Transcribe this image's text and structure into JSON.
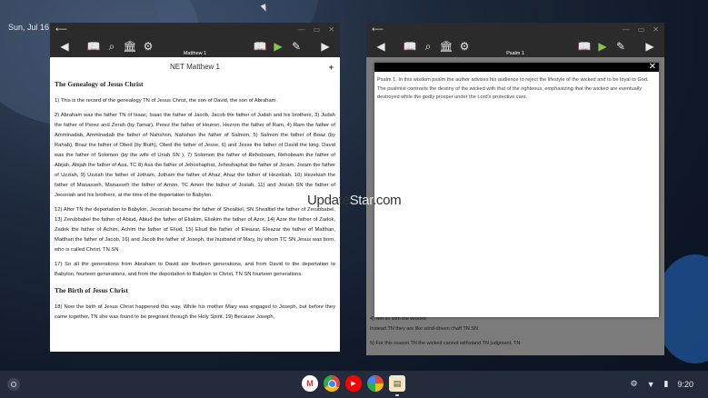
{
  "desktop": {
    "date": "Sun, Jul 16"
  },
  "left_window": {
    "subtitle": "Matthew 1",
    "page_title": "NET Matthew 1",
    "heading1": "The Genealogy of Jesus Christ",
    "heading2": "The Birth of Jesus Christ",
    "paragraphs": [
      "1)   This is the record of the genealogy  TN  of Jesus Christ, the son of David, the son of Abraham.",
      "2)   Abraham was the father  TN  of Isaac, Isaac the father of Jacob, Jacob the father of Judah and his brothers,   3)   Judah the father of Perez and Zerah (by Tamar), Perez the father of Hezron, Hezron the father of Ram,   4)   Ram the father of Amminadab, Amminadab the father of Nahshon, Nahshon the father of Salmon,   5)   Salmon the father of Boaz (by Rahab), Boaz the father of Obed (by Ruth), Obed the father of Jesse,   6)   and Jesse the father of David the king. David was the father of Solomon (by the wife of Uriah  SN ),   7)   Solomon the father of Rehoboam, Rehoboam the father of Abijah, Abijah the father of Asa,  TC   8)   Asa the father of Jehoshaphat, Jehoshaphat the father of Joram, Joram the father of Uzziah,   9)   Uzziah the father of Jotham, Jotham the father of Ahaz, Ahaz the father of Hezekiah,   10)   Hezekiah the father of Manasseh, Manasseh the father of Amon,  TC  Amon the father of Josiah,   11)   and Josiah  SN  the father of Jeconiah and his brothers, at the time of the deportation to Babylon.",
      "12)   After  TN  the deportation to Babylon, Jeconiah became the father of Shealtiel,  SN  Shealtiel the father of Zerubbabel,   13)   Zerubbabel the father of Abiud, Abiud the father of Eliakim, Eliakim the father of Azor,   14)   Azor the father of Zadok, Zadok the father of Achim, Achim the father of Eliud,   15)   Eliud the father of Eleazar, Eleazar the father of Matthan, Matthan the father of Jacob,   16)   and Jacob the father of Joseph, the husband of Mary, by whom  TC SN  Jesus was born, who is called Christ.  TN  SN",
      "17)   So all the generations from Abraham to David are fourteen generations, and from David to the deportation to Babylon, fourteen generations, and from the deportation to Babylon to Christ,  TN SN  fourteen generations.",
      "18)   Now the birth of Jesus Christ happened this way. While his mother Mary was engaged to Joseph, but before they came together,  TN  she was found to be pregnant through the Holy Spirit.   19)   Because Joseph,"
    ]
  },
  "right_window": {
    "subtitle": "Psalm 1",
    "popup_text": "Psalm 1. In this wisdom psalm the author advises his audience to reject the lifestyle of the wicked and to be loyal to God. The psalmist contrasts the destiny of the wicked with that of the righteous, emphasizing that the wicked are eventually destroyed while the godly prosper under the Lord's protective care.",
    "bg_line1": "4)   Not so with the wicked!",
    "bg_line2": "Instead  TN  they are like wind-driven chaff  TN  SN",
    "bg_line3": "5)   For this reason  TN  the wicked cannot withstand  TN  judgment,  TN"
  },
  "watermark": {
    "left": "Update",
    "mid": "Star",
    "right": ".com"
  },
  "shelf": {
    "time": "9:20",
    "apps": [
      "Gmail",
      "Chrome",
      "YouTube",
      "Photos",
      "Bible"
    ]
  },
  "icons": [
    "back-arrow-icon",
    "book-icon",
    "search-icon",
    "library-icon",
    "gear-icon",
    "open-book-icon",
    "play-icon",
    "pen-icon",
    "forward-arrow-icon",
    "close-icon",
    "settings-icon",
    "wifi-icon",
    "battery-icon"
  ]
}
